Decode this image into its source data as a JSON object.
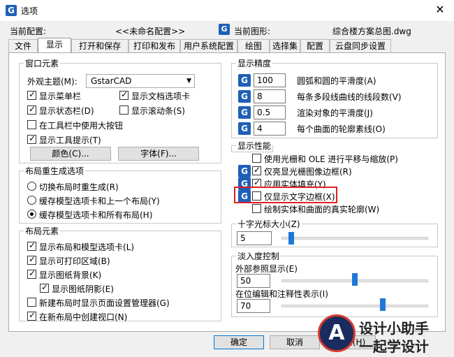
{
  "window": {
    "title": "选项",
    "app_icon_letter": "G",
    "close": "✕"
  },
  "header": {
    "profile_label": "当前配置:",
    "profile_value": "<<未命名配置>>",
    "drawing_label": "当前图形:",
    "drawing_value": "综合楼方案总图.dwg"
  },
  "tabs": [
    "文件",
    "显示",
    "打开和保存",
    "打印和发布",
    "用户系统配置",
    "绘图",
    "选择集",
    "配置",
    "云盘同步设置"
  ],
  "window_elements": {
    "title": "窗口元素",
    "theme_label": "外观主题(M):",
    "theme_value": "GstarCAD",
    "checkboxes": [
      {
        "label": "显示菜单栏",
        "checked": true
      },
      {
        "label": "显示文档选项卡",
        "checked": true
      },
      {
        "label": "显示状态栏(D)",
        "checked": true
      },
      {
        "label": "显示滚动条(S)",
        "checked": false
      },
      {
        "label": "在工具栏中使用大按钮",
        "checked": false
      },
      {
        "label": "显示工具提示(T)",
        "checked": true
      }
    ],
    "color_button": "颜色(C)...",
    "font_button": "字体(F)..."
  },
  "regen": {
    "title": "布局重生成选项",
    "options": [
      {
        "label": "切换布局时重生成(R)",
        "selected": false
      },
      {
        "label": "缓存模型选项卡和上一个布局(Y)",
        "selected": false
      },
      {
        "label": "缓存模型选项卡和所有布局(H)",
        "selected": true
      }
    ]
  },
  "layout_elements": {
    "title": "布局元素",
    "checkboxes": [
      {
        "label": "显示布局和模型选项卡(L)",
        "checked": true
      },
      {
        "label": "显示可打印区域(B)",
        "checked": true
      },
      {
        "label": "显示图纸背景(K)",
        "checked": true
      },
      {
        "label": "显示图纸阴影(E)",
        "checked": true
      },
      {
        "label": "新建布局时显示页面设置管理器(G)",
        "checked": false
      },
      {
        "label": "在新布局中创建视口(N)",
        "checked": true
      }
    ]
  },
  "precision": {
    "title": "显示精度",
    "rows": [
      {
        "value": "100",
        "label": "圆弧和圆的平滑度(A)"
      },
      {
        "value": "8",
        "label": "每条多段线曲线的线段数(V)"
      },
      {
        "value": "0.5",
        "label": "渲染对象的平滑度(J)"
      },
      {
        "value": "4",
        "label": "每个曲面的轮廓素线(O)"
      }
    ]
  },
  "performance": {
    "title": "显示性能",
    "checkboxes": [
      {
        "label": "使用光栅和 OLE 进行平移与缩放(P)",
        "checked": false
      },
      {
        "label": "仅亮显光栅图像边框(R)",
        "checked": true
      },
      {
        "label": "应用实体填充(Y)",
        "checked": true
      },
      {
        "label": "仅显示文字边框(X)",
        "checked": false
      },
      {
        "label": "绘制实体和曲面的真实轮廓(W)",
        "checked": false
      }
    ]
  },
  "crosshair": {
    "title": "十字光标大小(Z)",
    "value": "5",
    "level_percent": 5
  },
  "fade": {
    "title": "淡入度控制",
    "xref_label": "外部参照显示(E)",
    "xref_value": "50",
    "inplace_label": "在位编辑和注释性表示(I)",
    "inplace_value": "70"
  },
  "buttons": {
    "ok": "确定",
    "cancel": "取消",
    "help": "帮助(H)"
  },
  "watermark": {
    "line1": "设计小助手",
    "line2": "一起学设计"
  },
  "colors": {
    "accent": "#1e78d7",
    "highlight": "#e02020",
    "icon_blue": "#1f5fb8"
  }
}
